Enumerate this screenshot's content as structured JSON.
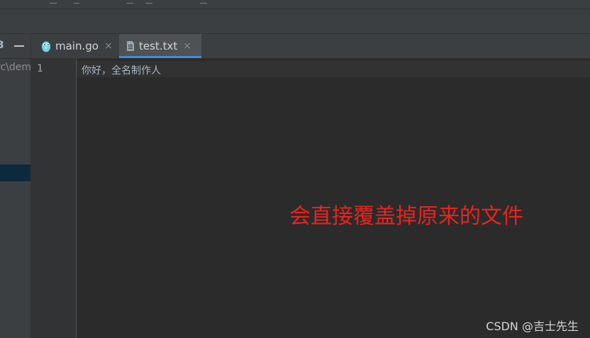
{
  "sidebar": {
    "path_fragment": "rc\\dem"
  },
  "tabs": [
    {
      "label": "main.go",
      "close": "×",
      "icon": "gopher-icon"
    },
    {
      "label": "test.txt",
      "close": "×",
      "icon": "text-file-icon",
      "active": true
    }
  ],
  "editor": {
    "line_numbers": [
      "1"
    ],
    "lines": [
      "你好，全名制作人"
    ],
    "annotation": "会直接覆盖掉原来的文件"
  },
  "watermark": "CSDN @吉士先生",
  "colors": {
    "background": "#2b2b2b",
    "panel": "#3c3f41",
    "gutter": "#313335",
    "text": "#a9b7c6",
    "active_tab_underline": "#4a88c7",
    "annotation": "#e8241f",
    "selection": "#0d293e"
  }
}
